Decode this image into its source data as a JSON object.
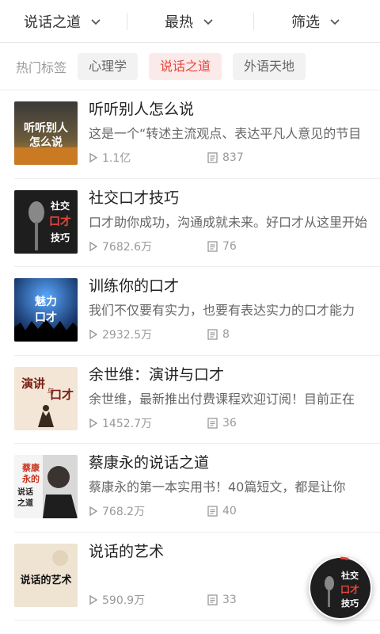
{
  "filters": [
    {
      "label": "说话之道"
    },
    {
      "label": "最热"
    },
    {
      "label": "筛选"
    }
  ],
  "hot_tags": {
    "label": "热门标签",
    "items": [
      {
        "label": "心理学",
        "active": false
      },
      {
        "label": "说话之道",
        "active": true
      },
      {
        "label": "外语天地",
        "active": false
      }
    ]
  },
  "items": [
    {
      "title": "听听别人怎么说",
      "desc": "这是一个“转述主流观点、表达平凡人意见的节目",
      "plays": "1.1亿",
      "episodes": "837",
      "cover_text": "听听别人怎么说"
    },
    {
      "title": "社交口才技巧",
      "desc": "口才助你成功，沟通成就未来。好口才从这里开始",
      "plays": "7682.6万",
      "episodes": "76",
      "cover_text": "社交口才技巧"
    },
    {
      "title": "训练你的口才",
      "desc": "我们不仅要有实力，也要有表达实力的口才能力",
      "plays": "2932.5万",
      "episodes": "8",
      "cover_text": "魅力口才"
    },
    {
      "title": "余世维：演讲与口才",
      "desc": "余世维，最新推出付费课程欢迎订阅！目前正在",
      "plays": "1452.7万",
      "episodes": "36",
      "cover_text": "演讲与口才"
    },
    {
      "title": "蔡康永的说话之道",
      "desc": "蔡康永的第一本实用书！40篇短文，都是让你",
      "plays": "768.2万",
      "episodes": "40",
      "cover_text": "蔡康永的说话之道"
    },
    {
      "title": "说话的艺术",
      "desc": "",
      "plays": "590.9万",
      "episodes": "33",
      "cover_text": "说话的艺术"
    }
  ],
  "player": {
    "cover_text": "社交口才技巧"
  },
  "colors": {
    "accent": "#e8453c",
    "tag_active_bg": "#fbeaea"
  }
}
